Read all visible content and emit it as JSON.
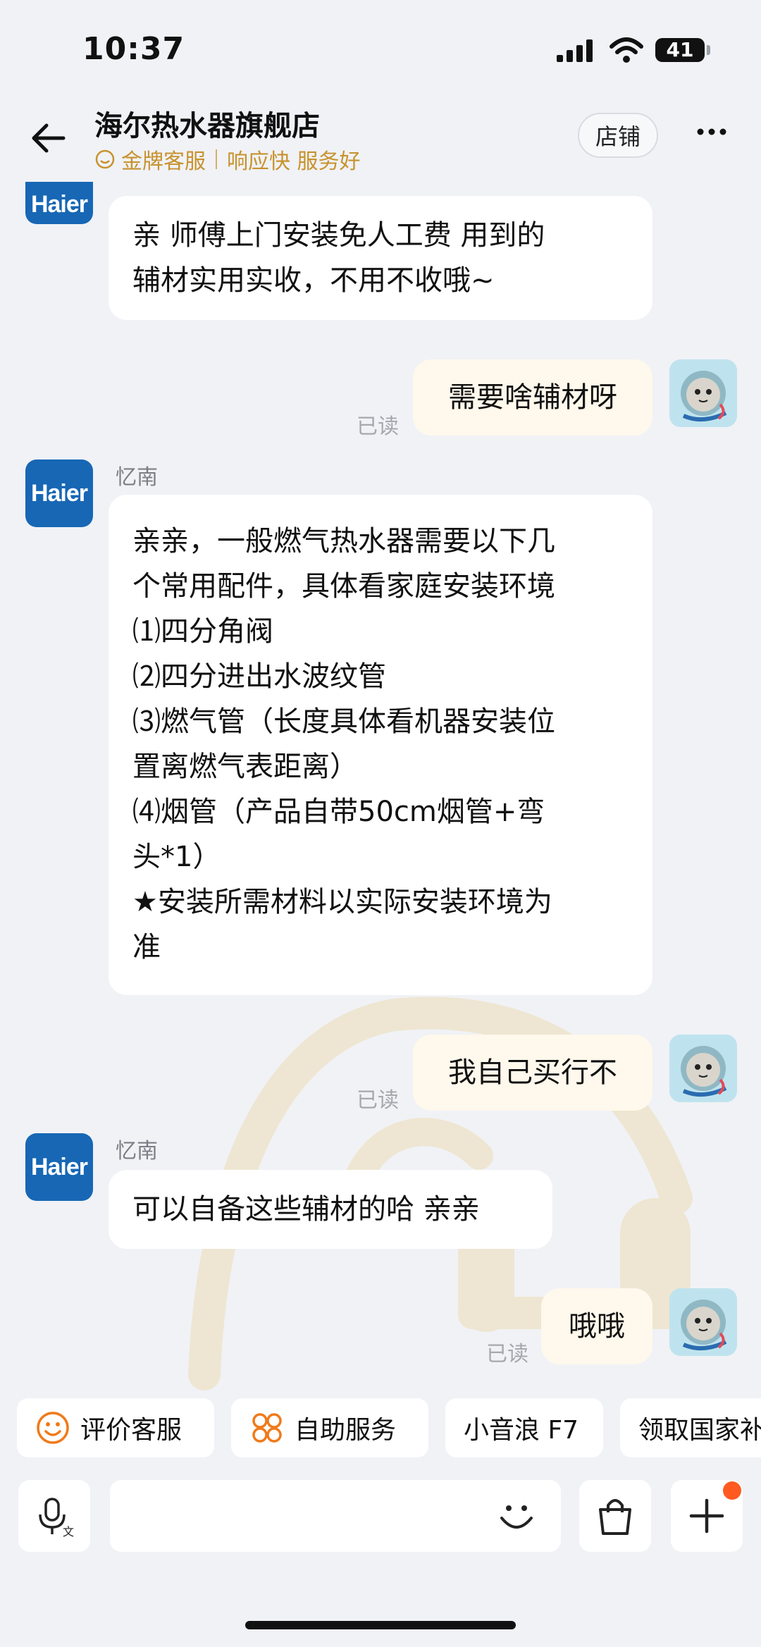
{
  "status_bar": {
    "time": "10:37",
    "battery": "41"
  },
  "header": {
    "title": "海尔热水器旗舰店",
    "badge": "金牌客服",
    "tags": "响应快 服务好",
    "store_button": "店铺"
  },
  "agent": {
    "logo_text": "Haier",
    "name": "忆南"
  },
  "messages": {
    "m1": {
      "lines": [
        "亲 师傅上门安装免人工费 用到的",
        "辅材实用实收，不用不收哦~"
      ]
    },
    "m2": {
      "text": "需要啥辅材呀",
      "status": "已读"
    },
    "m3": {
      "lines": [
        "亲亲，一般燃气热水器需要以下几",
        "个常用配件，具体看家庭安装环境",
        "⑴四分角阀",
        "⑵四分进出水波纹管",
        "⑶燃气管（长度具体看机器安装位",
        "置离燃气表距离）",
        "⑷烟管（产品自带50cm烟管+弯",
        "头*1）",
        "★安装所需材料以实际安装环境为",
        "准"
      ]
    },
    "m4": {
      "text": "我自己买行不",
      "status": "已读"
    },
    "m5": {
      "text": "可以自备这些辅材的哈 亲亲"
    },
    "m6": {
      "text": "哦哦",
      "status": "已读"
    }
  },
  "quick_actions": [
    "评价客服",
    "自助服务",
    "小音浪 F7",
    "领取国家补贴"
  ],
  "icons": [
    "back-arrow-icon",
    "smile-badge-icon",
    "more-icon",
    "voice-input-icon",
    "emoji-icon",
    "bag-icon",
    "plus-icon",
    "rate-smile-icon",
    "self-service-icon"
  ],
  "colors": {
    "brand_blue": "#1767b5",
    "gold": "#c8922d",
    "my_bubble": "#fff8ec",
    "accent_orange": "#ff5a1f"
  }
}
